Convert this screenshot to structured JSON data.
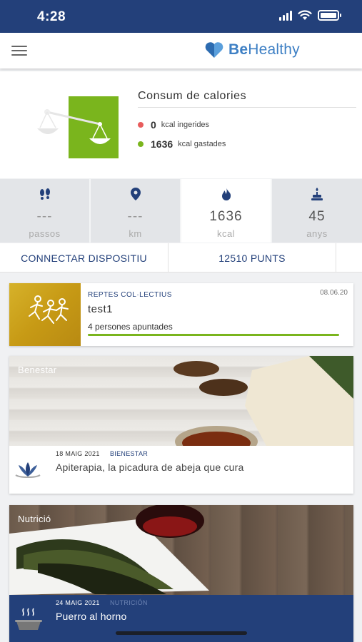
{
  "status_bar": {
    "time": "4:28"
  },
  "app": {
    "logo_prefix": "Be",
    "logo_suffix": "Healthy",
    "brand_color": "#3d7fc4"
  },
  "calories": {
    "title": "Consum de calories",
    "ingested_value": "0",
    "ingested_label": "kcal ingerides",
    "burned_value": "1636",
    "burned_label": "kcal gastades",
    "ingested_color": "#e85c5c",
    "burned_color": "#7ab51d"
  },
  "stats": [
    {
      "icon": "footsteps-icon",
      "value": "---",
      "label": "passos"
    },
    {
      "icon": "location-pin-icon",
      "value": "---",
      "label": "km"
    },
    {
      "icon": "flame-icon",
      "value": "1636",
      "label": "kcal"
    },
    {
      "icon": "birthday-cake-icon",
      "value": "45",
      "label": "anys"
    }
  ],
  "actions": {
    "connect": "CONNECTAR DISPOSITIU",
    "points": "12510 PUNTS"
  },
  "challenge": {
    "category": "REPTES COL·LECTIUS",
    "date": "08.06.20",
    "name": "test1",
    "people": "4 persones apuntades",
    "progress": 1.0
  },
  "articles": [
    {
      "tag": "Benestar",
      "date": "18 MAIG 2021",
      "category": "BIENESTAR",
      "title": "Apiterapia, la picadura de abeja que cura"
    },
    {
      "tag": "Nutrició",
      "date": "24 MAIG 2021",
      "category": "NUTRICIÓN",
      "title": "Puerro al horno"
    }
  ],
  "colors": {
    "navy": "#23407a",
    "green": "#7ab51d"
  }
}
